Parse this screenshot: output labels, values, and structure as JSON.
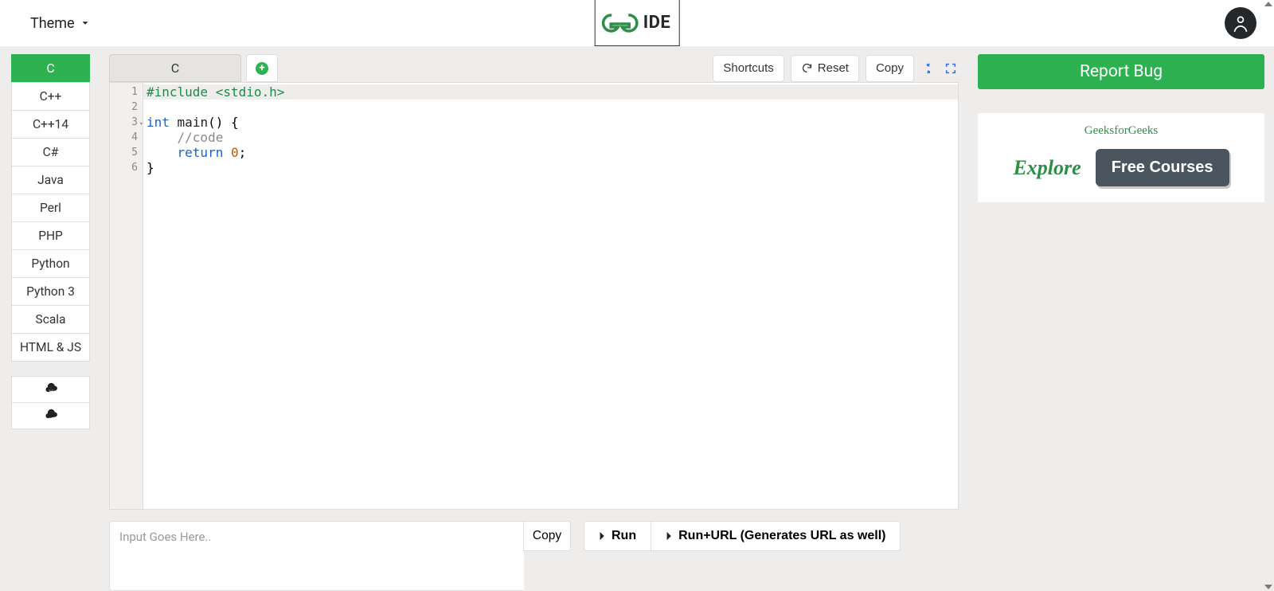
{
  "header": {
    "theme_label": "Theme",
    "ide_label": "IDE"
  },
  "sidebar": {
    "languages": [
      "C",
      "C++",
      "C++14",
      "C#",
      "Java",
      "Perl",
      "PHP",
      "Python",
      "Python 3",
      "Scala",
      "HTML & JS"
    ],
    "active_index": 0
  },
  "tabs": {
    "file_tab_label": "C",
    "add_symbol": "+"
  },
  "toolbar": {
    "shortcuts_label": "Shortcuts",
    "reset_label": "Reset",
    "copy_label": "Copy"
  },
  "editor": {
    "line_numbers": [
      "1",
      "2",
      "3",
      "4",
      "5",
      "6"
    ],
    "fold_line_index": 2,
    "highlight_line_index": 0,
    "code_tokens": [
      [
        [
          "tok-pp",
          "#include <stdio.h>"
        ]
      ],
      [
        [
          "",
          ""
        ]
      ],
      [
        [
          "tok-kw",
          "int"
        ],
        [
          "",
          " "
        ],
        [
          "tok-fn",
          "main"
        ],
        [
          "",
          "() {"
        ]
      ],
      [
        [
          "",
          "    "
        ],
        [
          "tok-cm",
          "//code"
        ]
      ],
      [
        [
          "",
          "    "
        ],
        [
          "tok-kw",
          "return"
        ],
        [
          "",
          " "
        ],
        [
          "tok-num",
          "0"
        ],
        [
          "",
          ";"
        ]
      ],
      [
        [
          "",
          "}"
        ]
      ]
    ]
  },
  "input": {
    "placeholder": "Input Goes Here..",
    "copy_label": "Copy"
  },
  "run": {
    "run_label": "Run",
    "run_url_label": "Run+URL (Generates URL as well)"
  },
  "right": {
    "report_bug_label": "Report Bug",
    "promo_brand": "GeeksforGeeks",
    "explore_label": "Explore",
    "free_courses_label": "Free Courses"
  }
}
